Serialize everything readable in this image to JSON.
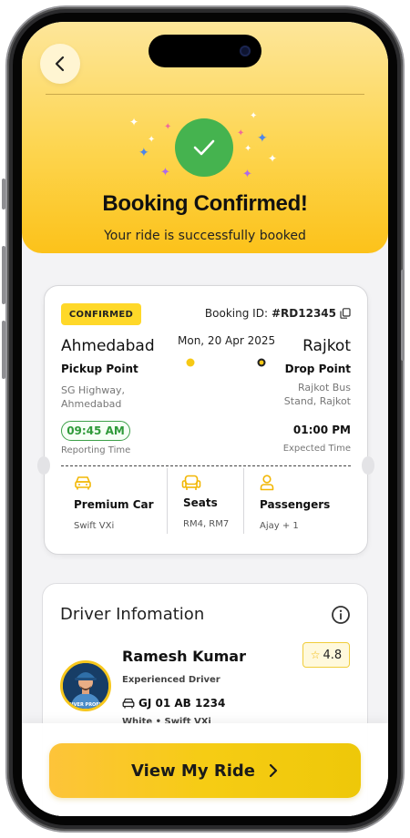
{
  "hero": {
    "title": "Booking Confirmed!",
    "subtitle": "Your ride is successfully booked"
  },
  "booking": {
    "status_badge": "CONFIRMED",
    "booking_id_label": "Booking ID:",
    "booking_id": "#RD12345",
    "date": "Mon, 20 Apr 2025",
    "from": {
      "city": "Ahmedabad",
      "label": "Pickup Point",
      "address_line1": "SG Highway,",
      "address_line2": "Ahmedabad",
      "time": "09:45 AM",
      "time_label": "Reporting Time"
    },
    "to": {
      "city": "Rajkot",
      "label": "Drop Point",
      "address_line1": "Rajkot Bus",
      "address_line2": "Stand, Rajkot",
      "time": "01:00 PM",
      "time_label": "Expected Time"
    },
    "features": [
      {
        "icon": "car-icon",
        "label": "Premium Car",
        "value": "Swift VXi"
      },
      {
        "icon": "seat-icon",
        "label": "Seats",
        "value": "RM4, RM7"
      },
      {
        "icon": "person-icon",
        "label": "Passengers",
        "value": "Ajay + 1"
      }
    ]
  },
  "driver": {
    "section_title": "Driver Infomation",
    "name": "Ramesh Kumar",
    "rating": "4.8",
    "experience": "Experienced Driver",
    "plate": "GJ 01 AB 1234",
    "car": "White • Swift VXi",
    "avatar_caption": "DRIVER PROFILE"
  },
  "cta": {
    "label": "View My Ride"
  },
  "colors": {
    "accent": "#fcc21a",
    "success": "#45b34f",
    "badge": "#ffd829"
  }
}
